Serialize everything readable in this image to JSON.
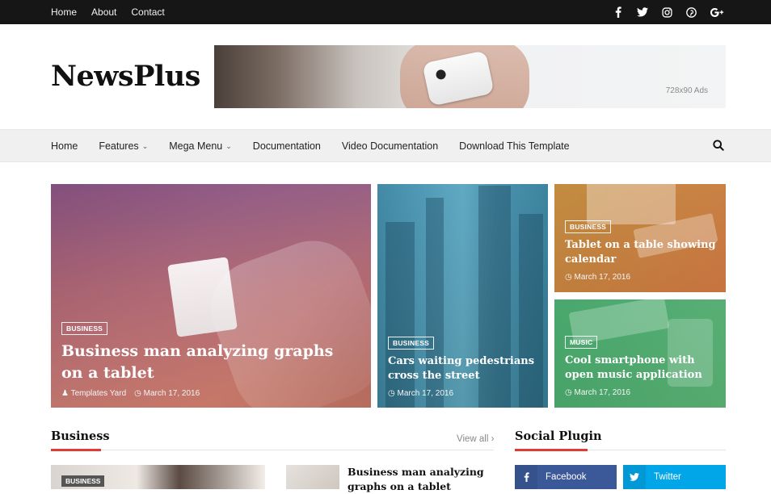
{
  "topbar": {
    "links": [
      "Home",
      "About",
      "Contact"
    ],
    "social_icons": [
      "facebook-icon",
      "twitter-icon",
      "instagram-icon",
      "pinterest-icon",
      "google-plus-icon"
    ]
  },
  "header": {
    "logo": "NewsPlus",
    "ad_label": "728x90 Ads"
  },
  "nav": {
    "items": [
      {
        "label": "Home",
        "dropdown": false
      },
      {
        "label": "Features",
        "dropdown": true
      },
      {
        "label": "Mega Menu",
        "dropdown": true
      },
      {
        "label": "Documentation",
        "dropdown": false
      },
      {
        "label": "Video Documentation",
        "dropdown": false
      },
      {
        "label": "Download This Template",
        "dropdown": false
      }
    ],
    "search_icon": "search-icon"
  },
  "featured": [
    {
      "badge": "BUSINESS",
      "title": "Business man analyzing graphs on a tablet",
      "author": "Templates Yard",
      "date": "March 17, 2016"
    },
    {
      "badge": "BUSINESS",
      "title": "Cars waiting pedestrians cross the street",
      "date": "March 17, 2016"
    },
    {
      "badge": "BUSINESS",
      "title": "Tablet on a table showing calendar",
      "date": "March 17, 2016"
    },
    {
      "badge": "MUSIC",
      "title": "Cool smartphone with open music application",
      "date": "March 17, 2016"
    }
  ],
  "business_section": {
    "title": "Business",
    "view_all": "View all",
    "badge": "BUSINESS",
    "post_title": "Business man analyzing graphs on a tablet"
  },
  "social_section": {
    "title": "Social Plugin",
    "buttons": [
      "Facebook",
      "Twitter"
    ]
  },
  "colors": {
    "accent": "#e53935",
    "facebook": "#3b5998",
    "twitter": "#00a6e8",
    "topbar": "#161616"
  }
}
